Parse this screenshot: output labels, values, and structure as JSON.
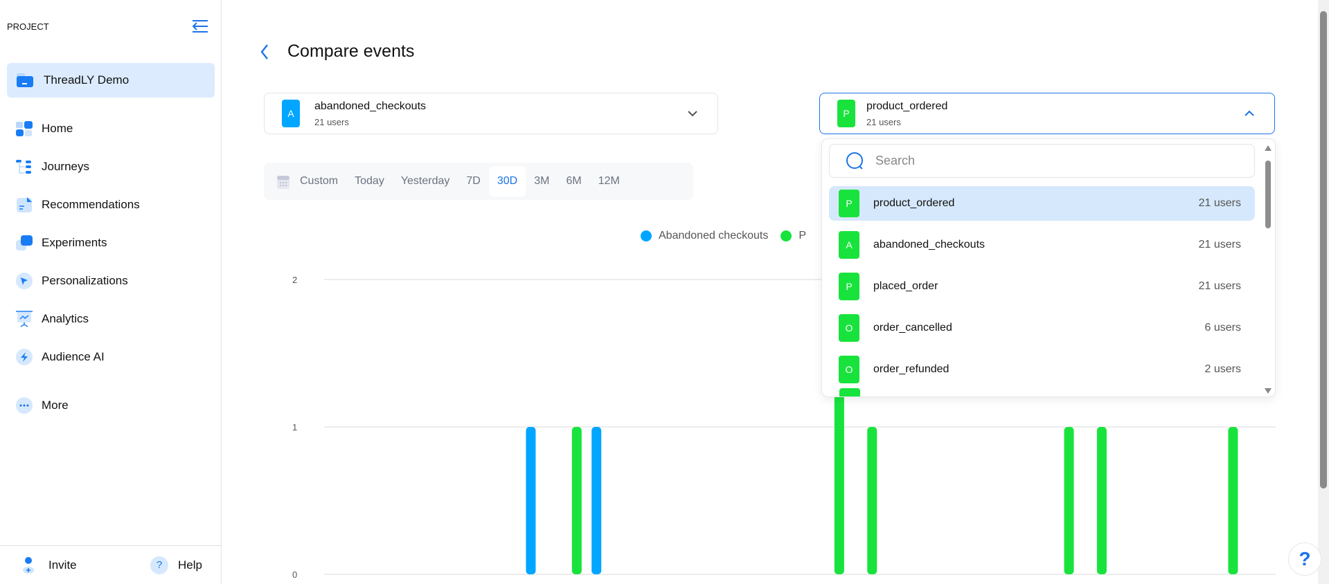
{
  "sidebar": {
    "section_label": "PROJECT",
    "project": "ThreadLY Demo",
    "items": [
      {
        "label": "Home",
        "icon": "home-icon"
      },
      {
        "label": "Journeys",
        "icon": "journeys-icon"
      },
      {
        "label": "Recommendations",
        "icon": "recommendations-icon"
      },
      {
        "label": "Experiments",
        "icon": "experiments-icon"
      },
      {
        "label": "Personalizations",
        "icon": "personalizations-icon"
      },
      {
        "label": "Analytics",
        "icon": "analytics-icon"
      },
      {
        "label": "Audience AI",
        "icon": "audience-ai-icon"
      }
    ],
    "more": "More",
    "invite": "Invite",
    "help": "Help"
  },
  "header": {
    "title": "Compare events"
  },
  "event_a": {
    "badge": "A",
    "name": "abandoned_checkouts",
    "count": "21 users",
    "color": "#00a6ff"
  },
  "event_b": {
    "badge": "P",
    "name": "product_ordered",
    "count": "21 users",
    "color": "#18e33d"
  },
  "date_range": {
    "options": [
      "Custom",
      "Today",
      "Yesterday",
      "7D",
      "30D",
      "3M",
      "6M",
      "12M"
    ],
    "selected": "30D"
  },
  "dropdown": {
    "search_placeholder": "Search",
    "items": [
      {
        "badge": "P",
        "name": "product_ordered",
        "count": "21 users",
        "selected": true
      },
      {
        "badge": "A",
        "name": "abandoned_checkouts",
        "count": "21 users"
      },
      {
        "badge": "P",
        "name": "placed_order",
        "count": "21 users"
      },
      {
        "badge": "O",
        "name": "order_cancelled",
        "count": "6 users"
      },
      {
        "badge": "O",
        "name": "order_refunded",
        "count": "2 users"
      }
    ]
  },
  "chart_data": {
    "type": "bar",
    "legend": [
      "Abandoned checkouts",
      "P"
    ],
    "legend_placement": "top-center",
    "ylim": [
      0,
      2
    ],
    "yticks": [
      "0",
      "1",
      "2"
    ],
    "grid": true,
    "series": [
      {
        "name": "Abandoned checkouts",
        "color": "#00a6ff",
        "values": [
          0,
          0,
          0,
          0,
          0,
          0,
          1,
          0,
          1,
          0,
          0,
          0,
          0,
          0,
          0,
          0,
          0,
          0,
          0,
          0,
          0,
          0,
          0,
          0,
          0,
          0,
          0,
          0,
          0
        ]
      },
      {
        "color": "#18e33d",
        "values": [
          0,
          0,
          0,
          0,
          0,
          0,
          0,
          1,
          0,
          0,
          0,
          0,
          0,
          0,
          0,
          2,
          1,
          0,
          0,
          0,
          0,
          0,
          1,
          1,
          0,
          0,
          0,
          1,
          0
        ]
      }
    ]
  }
}
